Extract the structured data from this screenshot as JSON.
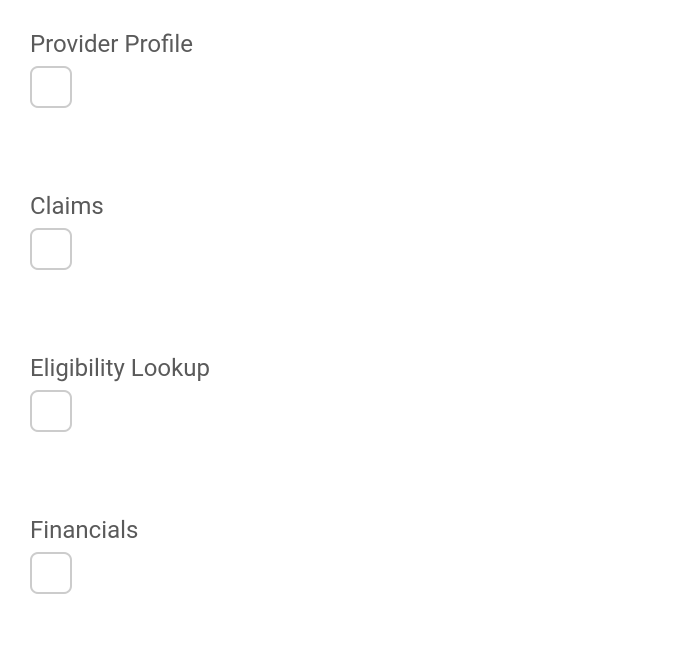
{
  "options": [
    {
      "label": "Provider Profile",
      "checked": false
    },
    {
      "label": "Claims",
      "checked": false
    },
    {
      "label": "Eligibility Lookup",
      "checked": false
    },
    {
      "label": "Financials",
      "checked": false
    }
  ]
}
